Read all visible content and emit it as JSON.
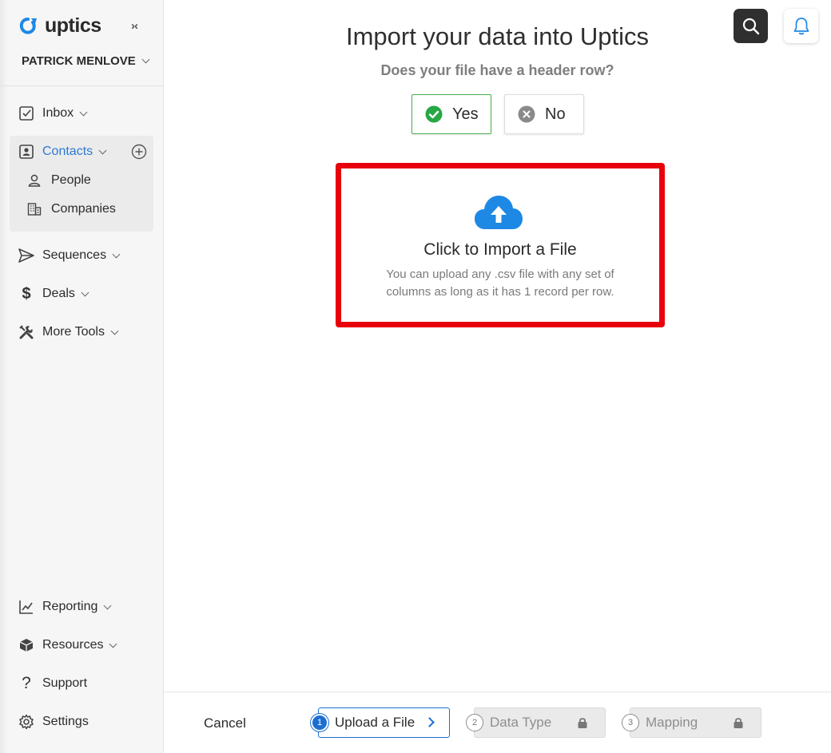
{
  "sidebar": {
    "brand": "uptics",
    "collapse_glyph": "›‹",
    "user_name": "PATRICK MENLOVE",
    "nav_top": [
      {
        "label": "Inbox",
        "icon": "inbox-icon"
      },
      {
        "label": "Contacts",
        "icon": "contacts-icon",
        "active": true
      },
      {
        "label": "Sequences",
        "icon": "send-icon"
      },
      {
        "label": "Deals",
        "icon": "dollar-icon"
      },
      {
        "label": "More Tools",
        "icon": "tools-icon"
      }
    ],
    "contacts_sub": [
      {
        "label": "People",
        "icon": "person-icon"
      },
      {
        "label": "Companies",
        "icon": "building-icon"
      }
    ],
    "nav_bottom": [
      {
        "label": "Reporting",
        "icon": "chart-icon"
      },
      {
        "label": "Resources",
        "icon": "box-icon"
      },
      {
        "label": "Support",
        "icon": "question-icon"
      },
      {
        "label": "Settings",
        "icon": "gear-icon"
      }
    ]
  },
  "main": {
    "title": "Import your data into Uptics",
    "subtitle": "Does your file have a header row?",
    "yes_label": "Yes",
    "no_label": "No",
    "upload": {
      "title": "Click to Import a File",
      "description": "You can upload any .csv file with any set of columns as long as it has 1 record per row."
    }
  },
  "footer": {
    "cancel_label": "Cancel",
    "steps": [
      {
        "num": "1",
        "label": "Upload a File",
        "state": "active"
      },
      {
        "num": "2",
        "label": "Data Type",
        "state": "locked"
      },
      {
        "num": "3",
        "label": "Mapping",
        "state": "locked"
      }
    ]
  },
  "colors": {
    "accent_blue": "#2d7ad6",
    "upload_blue": "#1e88e5",
    "success_green": "#4caf50",
    "highlight_red": "#e8000b"
  }
}
